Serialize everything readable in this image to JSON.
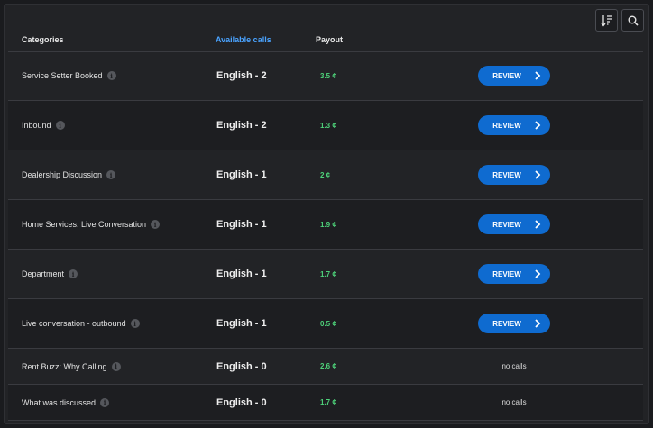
{
  "table": {
    "columns": {
      "categories": "Categories",
      "available_calls": "Available calls",
      "payout": "Payout"
    },
    "rows": [
      {
        "category": "Service Setter Booked",
        "available": "English - 2",
        "payout": "3.5 ¢",
        "action": "REVIEW"
      },
      {
        "category": "Inbound",
        "available": "English - 2",
        "payout": "1.3 ¢",
        "action": "REVIEW"
      },
      {
        "category": "Dealership Discussion",
        "available": "English - 1",
        "payout": "2 ¢",
        "action": "REVIEW"
      },
      {
        "category": "Home Services: Live Conversation",
        "available": "English - 1",
        "payout": "1.9 ¢",
        "action": "REVIEW"
      },
      {
        "category": "Department",
        "available": "English - 1",
        "payout": "1.7 ¢",
        "action": "REVIEW"
      },
      {
        "category": "Live conversation - outbound",
        "available": "English - 1",
        "payout": "0.5 ¢",
        "action": "REVIEW"
      },
      {
        "category": "Rent Buzz: Why Calling",
        "available": "English - 0",
        "payout": "2.6 ¢",
        "action": "no calls"
      },
      {
        "category": "What was discussed",
        "available": "English - 0",
        "payout": "1.7 ¢",
        "action": "no calls"
      }
    ]
  },
  "info_glyph": "i",
  "toolbar": {
    "sort_icon": "sort-icon",
    "search_icon": "search-icon"
  },
  "colors": {
    "accent": "#0f6bd0",
    "header_link": "#4aa3ff",
    "payout": "#4ed27a"
  }
}
